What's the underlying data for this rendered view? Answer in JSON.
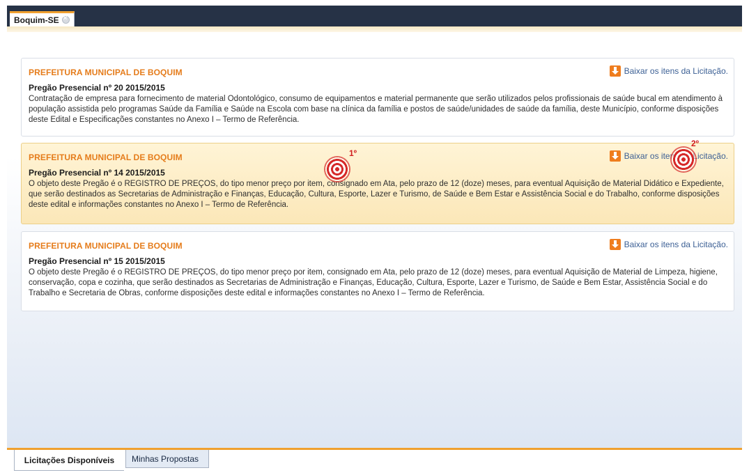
{
  "header": {
    "tab_label": "Boquim-SE",
    "tab_close_icon": "close-icon"
  },
  "cards": [
    {
      "title": "PREFEITURA MUNICIPAL DE BOQUIM",
      "subtitle": "Pregão Presencial nº 20 2015/2015",
      "description": "Contratação de empresa para fornecimento de material Odontológico, consumo de equipamentos e material permanente que serão utilizados pelos profissionais de saúde bucal em atendimento à população assistida pelo programas Saúde da Família e Saúde na Escola com base na clínica da família e postos de saúde/unidades de saúde da família, deste Município, conforme disposições deste Edital e Especificações constantes no Anexo I – Termo de Referência.",
      "download_label": "Baixar os itens da Licitação.",
      "highlighted": false
    },
    {
      "title": "PREFEITURA MUNICIPAL DE BOQUIM",
      "subtitle": "Pregão Presencial nº 14 2015/2015",
      "description": "O objeto deste Pregão é o REGISTRO DE PREÇOS, do tipo menor preço por item, consignado em Ata, pelo prazo de 12 (doze) meses, para eventual Aquisição de Material Didático e Expediente, que serão destinados as Secretarias de Administração e Finanças, Educação, Cultura, Esporte, Lazer e Turismo, de Saúde e Bem Estar e Assistência Social e do Trabalho, conforme disposições deste edital e informações constantes no Anexo I – Termo de Referência.",
      "download_label": "Baixar os itens da Licitação.",
      "highlighted": true
    },
    {
      "title": "PREFEITURA MUNICIPAL DE BOQUIM",
      "subtitle": "Pregão Presencial nº 15 2015/2015",
      "description": "O objeto deste Pregão é o REGISTRO DE PREÇOS, do tipo menor preço por item, consignado em Ata, pelo prazo de 12 (doze) meses, para eventual Aquisição de Material de Limpeza, higiene, conservação, copa e cozinha, que serão destinados as Secretarias de Administração e Finanças, Educação, Cultura, Esporte, Lazer e Turismo, de Saúde e Bem Estar, Assistência Social e do Trabalho e Secretaria de Obras, conforme disposições deste edital e informações constantes no Anexo I – Termo de Referência.",
      "download_label": "Baixar os itens da Licitação.",
      "highlighted": false
    }
  ],
  "annotations": {
    "first_label": "1º",
    "second_label": "2º",
    "marker_color": "#d62a2a"
  },
  "bottom_tabs": {
    "active_label": "Licitações Disponíveis",
    "inactive_label": "Minhas Propostas"
  },
  "colors": {
    "header_bar": "#263246",
    "accent": "#f0a030",
    "title_orange": "#e57c1b",
    "link_blue": "#3b5f94",
    "highlight_bg": "#fbe7b8"
  }
}
